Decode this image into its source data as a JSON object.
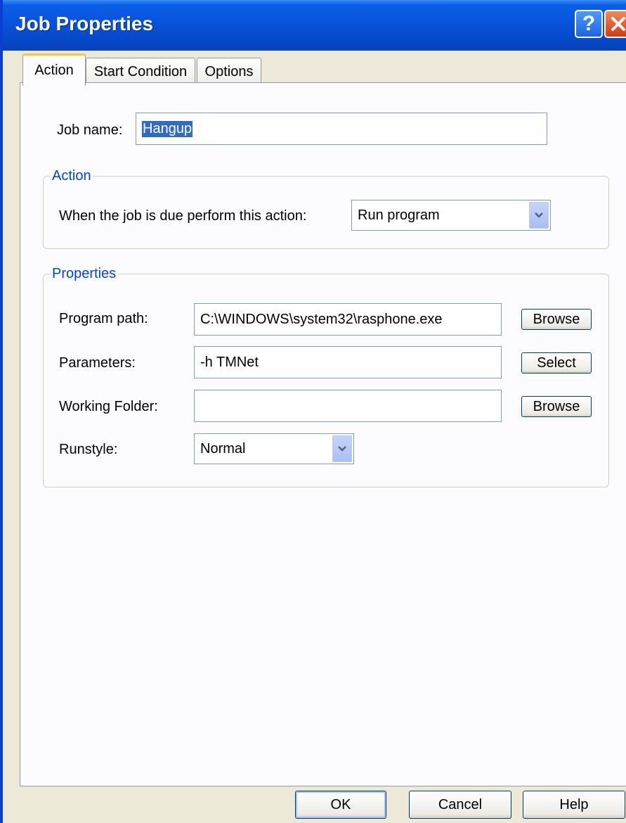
{
  "window": {
    "title": "Job Properties"
  },
  "tabs": [
    {
      "label": "Action"
    },
    {
      "label": "Start Condition"
    },
    {
      "label": "Options"
    }
  ],
  "job_name": {
    "label": "Job name:",
    "value": "Hangup"
  },
  "action_group": {
    "legend": "Action",
    "label": "When the job is due perform this action:",
    "selected": "Run program"
  },
  "properties_group": {
    "legend": "Properties",
    "program_path": {
      "label": "Program path:",
      "value": "C:\\WINDOWS\\system32\\rasphone.exe",
      "button": "Browse"
    },
    "parameters": {
      "label": "Parameters:",
      "value": "-h TMNet",
      "button": "Select"
    },
    "working_folder": {
      "label": "Working Folder:",
      "value": "",
      "button": "Browse"
    },
    "runstyle": {
      "label": "Runstyle:",
      "selected": "Normal"
    }
  },
  "footer": {
    "ok": "OK",
    "cancel": "Cancel",
    "help": "Help"
  },
  "colors": {
    "titlebar": "#0855dd",
    "group_legend": "#0046d5",
    "active_tab_highlight": "#ffc83c",
    "selection": "#316ac5"
  },
  "icons": {
    "help": "question-mark-icon",
    "close": "close-x-icon",
    "dropdown": "chevron-down-icon"
  }
}
